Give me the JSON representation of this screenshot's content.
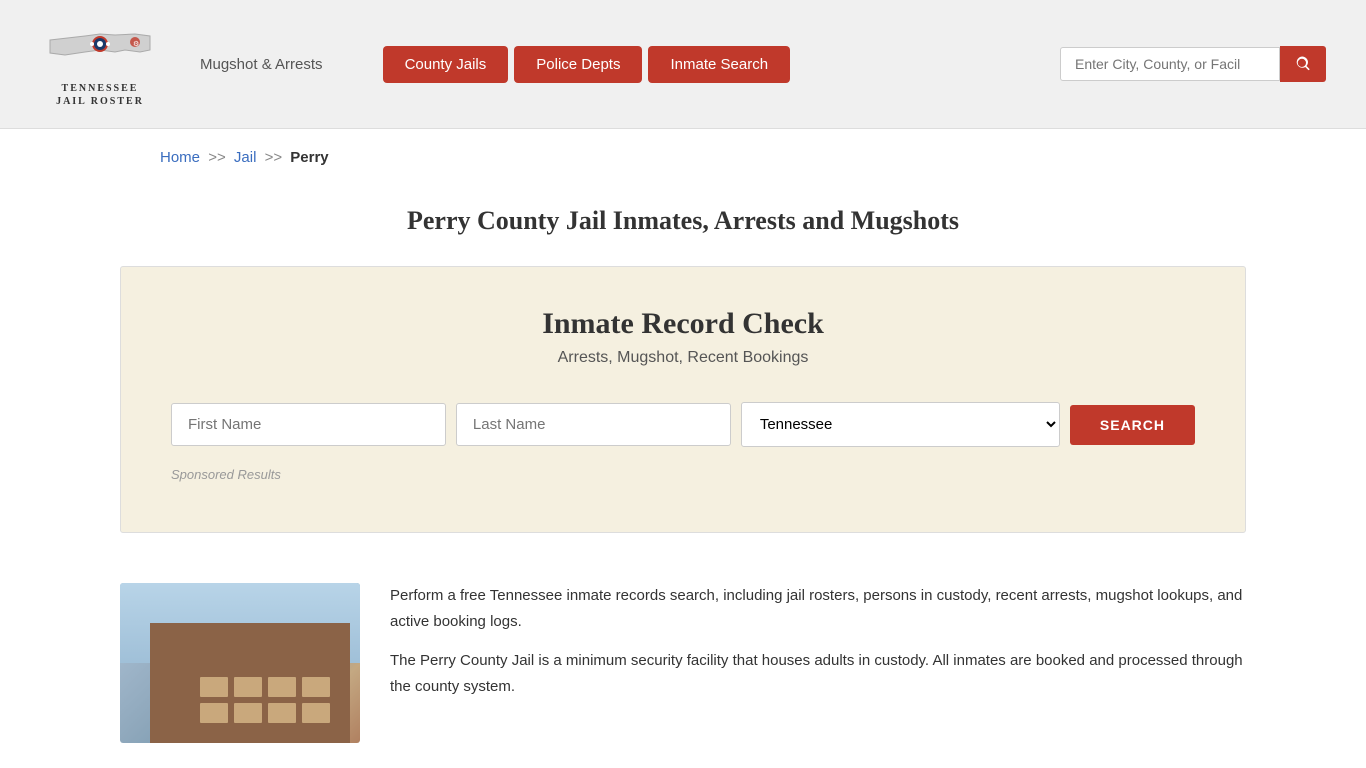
{
  "header": {
    "logo_text": "Tennessee\nJail Roster",
    "mugshot_link": "Mugshot & Arrests",
    "nav_buttons": [
      {
        "label": "County Jails",
        "id": "county-jails"
      },
      {
        "label": "Police Depts",
        "id": "police-depts"
      },
      {
        "label": "Inmate Search",
        "id": "inmate-search"
      }
    ],
    "search_placeholder": "Enter City, County, or Facil"
  },
  "breadcrumb": {
    "home": "Home",
    "sep1": ">>",
    "jail": "Jail",
    "sep2": ">>",
    "current": "Perry"
  },
  "page": {
    "title": "Perry County Jail Inmates, Arrests and Mugshots"
  },
  "record_box": {
    "title": "Inmate Record Check",
    "subtitle": "Arrests, Mugshot, Recent Bookings",
    "first_name_placeholder": "First Name",
    "last_name_placeholder": "Last Name",
    "state_default": "Tennessee",
    "search_button": "SEARCH",
    "sponsored_label": "Sponsored Results"
  },
  "content": {
    "paragraph1": "Perform a free Tennessee inmate records search, including jail rosters, persons in custody, recent arrests, mugshot lookups, and active booking logs.",
    "paragraph2": "The Perry County Jail is a minimum security facility that houses adults in custody. All inmates are booked and processed through the county system."
  }
}
